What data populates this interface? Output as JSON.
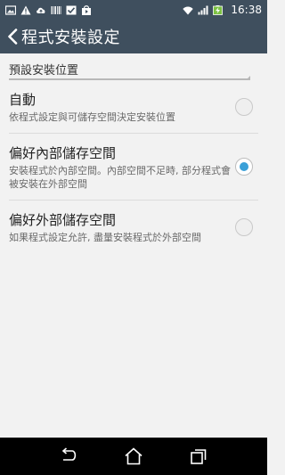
{
  "status_bar": {
    "time": "16:38",
    "left_icons": [
      "image-icon",
      "warning-icon",
      "cloud-upload-icon",
      "barcode-icon",
      "checkbox-icon",
      "shopping-bag-icon"
    ],
    "right_icons": [
      "wifi-icon",
      "signal-icon",
      "battery-charging-icon"
    ]
  },
  "app_bar": {
    "title": "程式安裝設定",
    "back_icon": "chevron-left-icon"
  },
  "category": {
    "title": "預設安裝位置"
  },
  "options": [
    {
      "title": "自動",
      "description": "依程式設定與可儲存空間決定安裝位置",
      "selected": false
    },
    {
      "title": "偏好內部儲存空間",
      "description": "安裝程式於內部空間。內部空間不足時, 部分程式會被安裝在外部空間",
      "selected": true
    },
    {
      "title": "偏好外部儲存空間",
      "description": "如果程式設定允許, 盡量安裝程式於外部空間",
      "selected": false
    }
  ],
  "nav_bar": {
    "icons": [
      "back-icon",
      "home-icon",
      "recent-apps-icon"
    ]
  },
  "colors": {
    "app_bar": "#3f4f5e",
    "background": "#f2f2f2",
    "radio_accent": "#3aa0d8"
  }
}
